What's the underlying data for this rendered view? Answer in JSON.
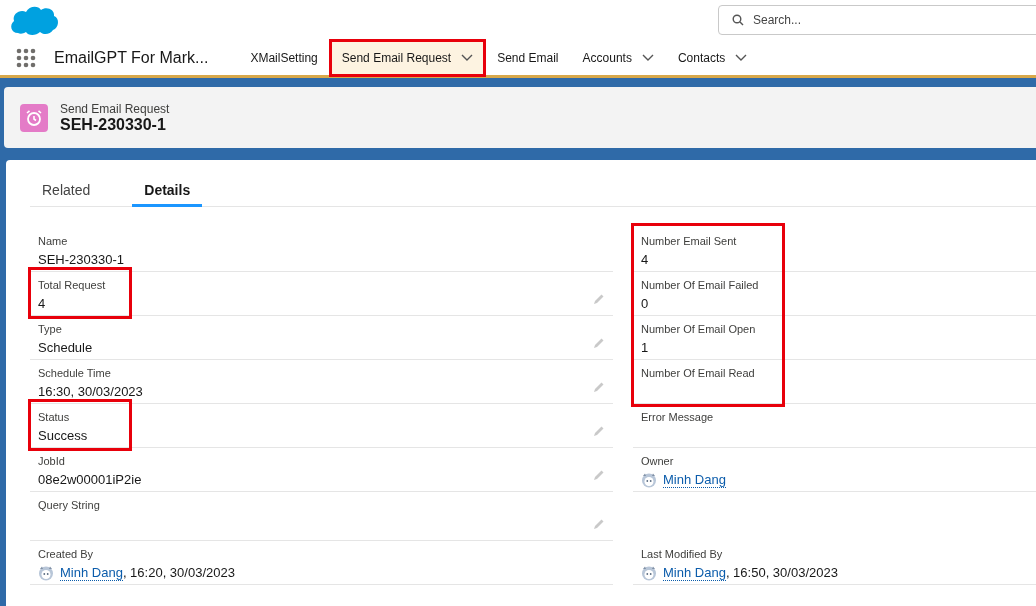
{
  "search": {
    "placeholder": "Search..."
  },
  "app_name": "EmailGPT For Mark...",
  "nav_items": [
    {
      "label": "XMailSetting",
      "has_menu": false,
      "selected": false,
      "highlighted": false
    },
    {
      "label": "Send Email Request",
      "has_menu": true,
      "selected": true,
      "highlighted": true
    },
    {
      "label": "Send Email",
      "has_menu": false,
      "selected": false,
      "highlighted": false
    },
    {
      "label": "Accounts",
      "has_menu": true,
      "selected": false,
      "highlighted": false
    },
    {
      "label": "Contacts",
      "has_menu": true,
      "selected": false,
      "highlighted": false
    }
  ],
  "record_header": {
    "object_type": "Send Email Request",
    "title": "SEH-230330-1"
  },
  "tabs": [
    {
      "label": "Related",
      "selected": false
    },
    {
      "label": "Details",
      "selected": true
    }
  ],
  "left_fields": [
    {
      "kind": "text",
      "label": "Name",
      "value": "SEH-230330-1",
      "editable": false,
      "highlighted": false
    },
    {
      "kind": "text",
      "label": "Total Request",
      "value": "4",
      "editable": true,
      "highlighted": true
    },
    {
      "kind": "text",
      "label": "Type",
      "value": "Schedule",
      "editable": true,
      "highlighted": false
    },
    {
      "kind": "text",
      "label": "Schedule Time",
      "value": "16:30, 30/03/2023",
      "editable": true,
      "highlighted": false
    },
    {
      "kind": "text",
      "label": "Status",
      "value": "Success",
      "editable": true,
      "highlighted": true
    },
    {
      "kind": "text",
      "label": "JobId",
      "value": "08e2w00001iP2ie",
      "editable": true,
      "highlighted": false
    },
    {
      "kind": "text",
      "label": "Query String",
      "editable": true,
      "highlighted": false
    }
  ],
  "right_fields": [
    {
      "kind": "text",
      "label": "Number Email Sent",
      "value": "4",
      "editable": false,
      "highlighted": true
    },
    {
      "kind": "text",
      "label": "Number Of Email Failed",
      "value": "0",
      "editable": false,
      "highlighted": true
    },
    {
      "kind": "text",
      "label": "Number Of Email Open",
      "value": "1",
      "editable": false,
      "highlighted": true
    },
    {
      "kind": "text",
      "label": "Number Of Email Read",
      "editable": false,
      "highlighted": true
    },
    {
      "kind": "text",
      "label": "Error Message",
      "editable": false,
      "highlighted": false
    },
    {
      "kind": "user",
      "label": "Owner",
      "user": "Minh Dang",
      "editable": false,
      "highlighted": false
    }
  ],
  "system_fields": [
    {
      "kind": "user",
      "label": "Created By",
      "user": "Minh Dang",
      "suffix": ", 16:20, 30/03/2023",
      "editable": false,
      "highlighted": false
    },
    {
      "kind": "user",
      "label": "Last Modified By",
      "user": "Minh Dang",
      "suffix": ", 16:50, 30/03/2023",
      "editable": false,
      "highlighted": false
    }
  ]
}
